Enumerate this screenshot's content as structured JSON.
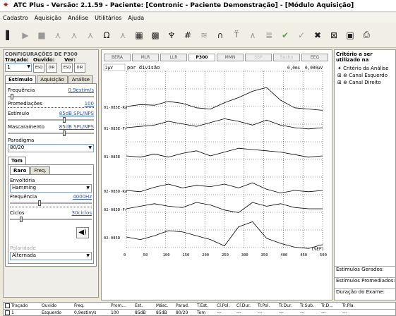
{
  "window": {
    "title": "ATC Plus - Versão: 2.1.59 - Paciente: [Contronic - Paciente Demonstração] - [Módulo Aquisição]"
  },
  "menu": [
    "Cadastro",
    "Aquisição",
    "Análise",
    "Utilitários",
    "Ajuda"
  ],
  "toolbar": {
    "icons": [
      "stop-bar-icon",
      "play-icon",
      "stop-icon",
      "wave-add-icon",
      "wave-sub-icon",
      "wave-icon",
      "ohm-icon",
      "wave-mark-icon",
      "grid-icon",
      "grid-select-icon",
      "marker-icon",
      "hash-icon",
      "filter-icon",
      "envelope-icon",
      "stand-icon",
      "peak-icon",
      "layers-icon",
      "check-icon",
      "check-wave-icon",
      "close-icon",
      "x-wave-icon",
      "save-icon",
      "print-icon"
    ]
  },
  "config": {
    "title": "CONFIGURAÇÕES DE P300",
    "tracado_label": "Traçado:",
    "tracado_value": "1",
    "ouvido_label": "Ouvido:",
    "ver_label": "Ver:",
    "btn_esq": "ESQ",
    "btn_dir": "DIR",
    "tabs": [
      "Estímulo",
      "Aquisição",
      "Análise"
    ],
    "frequencia_label": "Frequência",
    "frequencia_value": "0,9estim/s",
    "promediacoes_label": "Promediações",
    "promediacoes_value": "100",
    "estimulo_label": "Estímulo",
    "estimulo_value": "85dB SPL/NPS",
    "mascaramento_label": "Mascaramento",
    "mascaramento_value": "85dB SPL/NPS",
    "paradigma_label": "Paradigma",
    "paradigma_value": "80/20",
    "sub_tab": "Tom",
    "sub_tabs": [
      "Raro",
      "Freq."
    ],
    "envoltoria_label": "Envoltória",
    "envoltoria_value": "Hamming",
    "freq_label": "Frequência",
    "freq_value": "4000Hz",
    "ciclos_label": "Ciclos",
    "ciclos_value": "30ciclos",
    "polaridade_label": "Polaridade",
    "polaridade_value": "Alternada"
  },
  "graph": {
    "tabs": [
      "BERA",
      "MLR",
      "LLR",
      "P300",
      "MMN",
      "SSP",
      "Eecho",
      "EEG"
    ],
    "scale": "2µV",
    "scale_unit": "por divisão",
    "readout_time": "0,0ms",
    "readout_amp": "0,000µV",
    "labels": [
      "01-085E-Ra",
      "01-085E-Fr",
      "01-085E",
      "02-085D-Ra",
      "02-085D-Fr",
      "02-085D"
    ],
    "x_ticks": [
      "0",
      "50",
      "100",
      "150",
      "200",
      "250",
      "300",
      "350",
      "400",
      "450",
      "500"
    ],
    "corner": "(%EF)"
  },
  "right_panel": {
    "title": "Critério a ser utilizado na",
    "tree": [
      "Critério da Análise",
      "Canal Esquerdo",
      "Canal Direito"
    ],
    "estimulos_gerados": "Estímulos Gerados:",
    "estimulos_promediados": "Estímulos Promediados:",
    "duracao": "Duração do Exame:"
  },
  "table": {
    "headers": [
      "Traçado",
      "Ouvido",
      "Freq.",
      "Prom...",
      "Est.",
      "Másc.",
      "Parad.",
      "T.Est.",
      "Cl.Pol.",
      "Cl.Dur.",
      "Tr.Pol.",
      "Tr.Dur.",
      "Tr.Sub.",
      "Tr.D...",
      "Tr.Pla."
    ],
    "row": [
      "1",
      "Esquerdo",
      "0,9estim/s",
      "100",
      "85dB",
      "85dB",
      "80/20",
      "Tom",
      "---",
      "---",
      "---",
      "---",
      "---",
      "---",
      "---"
    ]
  },
  "colors": {
    "accent": "#3058a8",
    "window_bg": "#ece9d8"
  }
}
